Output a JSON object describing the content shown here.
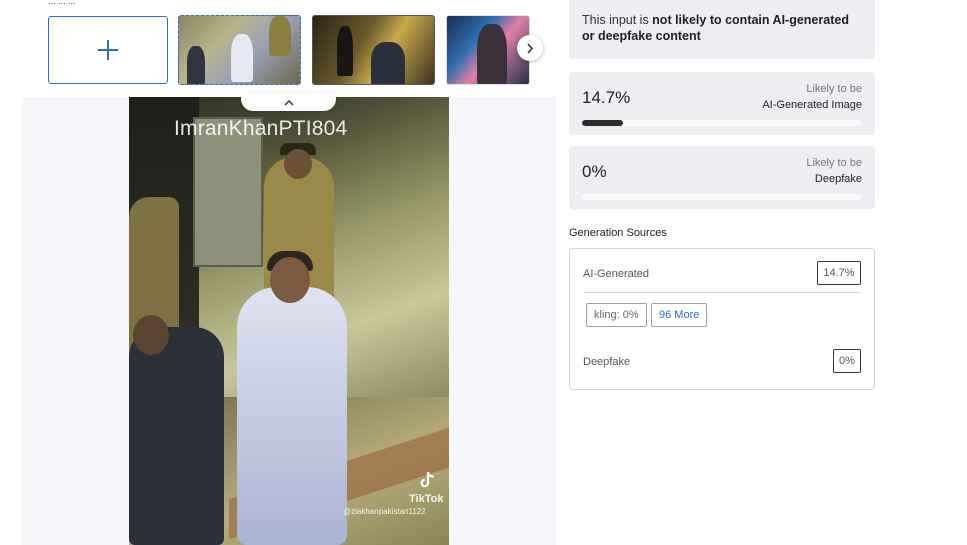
{
  "gallery": {
    "top_text": "... ... ...",
    "add_label": "+",
    "thumbnails": [
      {
        "name": "thumbnail-1"
      },
      {
        "name": "thumbnail-2"
      },
      {
        "name": "thumbnail-3"
      }
    ],
    "next_icon": "chevron-right-icon",
    "collapse_icon": "chevron-up-icon"
  },
  "preview": {
    "watermark_title": "ImranKhanPTI804",
    "platform": "TikTok",
    "username": "@ziakhanpakistan1122"
  },
  "result": {
    "notice_prefix": "This input is ",
    "notice_bold": "not likely to contain AI-generated or deepfake content",
    "ai_image": {
      "percent": "14.7%",
      "likely_label": "Likely to be",
      "kind": "AI-Generated Image",
      "fill_fraction": 0.147
    },
    "deepfake": {
      "percent": "0%",
      "likely_label": "Likely to be",
      "kind": "Deepfake",
      "fill_fraction": 0
    }
  },
  "generation_sources": {
    "title": "Generation Sources",
    "ai_generated_label": "AI-Generated",
    "ai_generated_value": "14.7%",
    "chips": [
      "kling: 0%",
      "96 More"
    ],
    "deepfake_label": "Deepfake",
    "deepfake_value": "0%"
  },
  "colors": {
    "accent": "#2e6bd0",
    "bar_fill": "#2c2c2c",
    "card_bg": "#eceef1"
  }
}
